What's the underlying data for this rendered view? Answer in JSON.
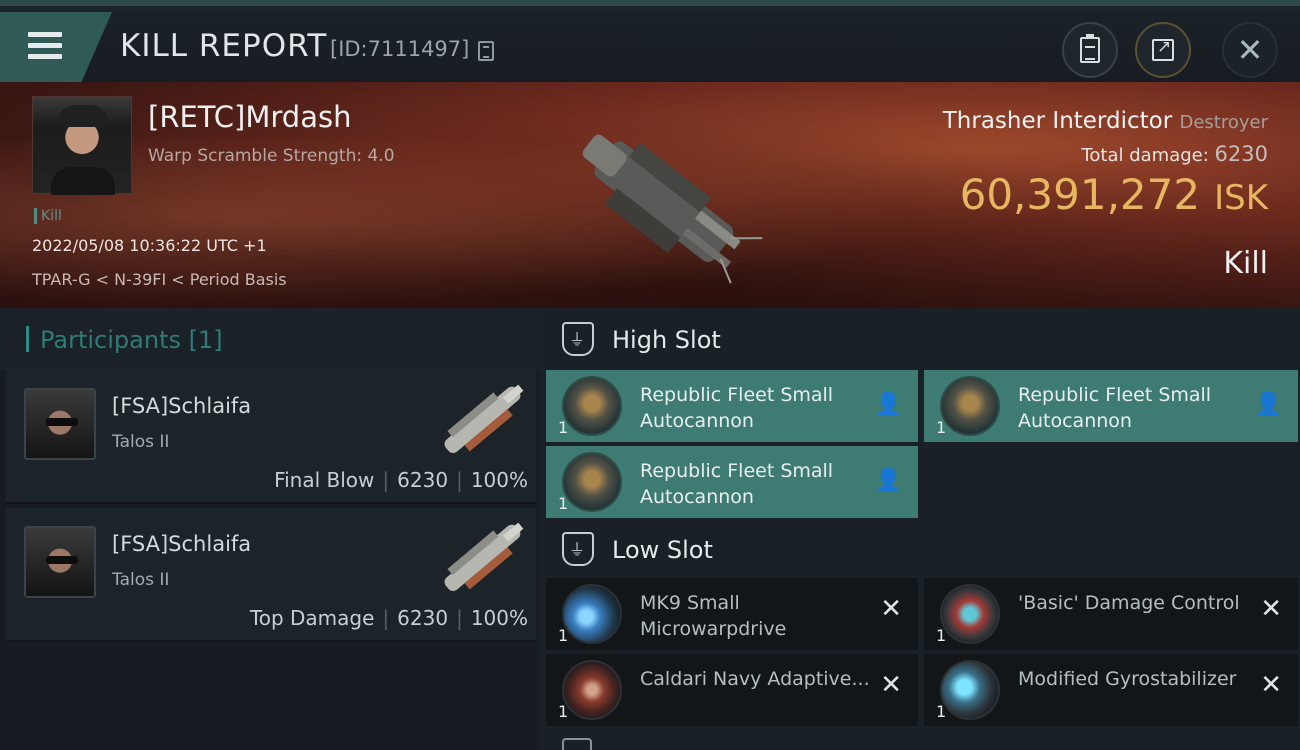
{
  "header": {
    "title": "KILL REPORT",
    "kill_id": "[ID:7111497]"
  },
  "victim": {
    "name": "[RETC]Mrdash",
    "warp_scramble": "Warp Scramble Strength: 4.0",
    "kill_tag": "Kill",
    "datetime": "2022/05/08 10:36:22 UTC +1",
    "location": "TPAR-G < N-39FI < Period Basis",
    "ship_name": "Thrasher Interdictor",
    "ship_class": "Destroyer",
    "total_damage_label": "Total damage:",
    "total_damage": "6230",
    "isk_value": "60,391,272",
    "isk_unit": "ISK",
    "result": "Kill"
  },
  "participants": {
    "header": "Participants [1]",
    "rows": [
      {
        "name": "[FSA]Schlaifa",
        "ship": "Talos II",
        "role": "Final Blow",
        "damage": "6230",
        "percent": "100%"
      },
      {
        "name": "[FSA]Schlaifa",
        "ship": "Talos II",
        "role": "Top Damage",
        "damage": "6230",
        "percent": "100%"
      }
    ]
  },
  "fitting": {
    "high_slot": {
      "title": "High Slot",
      "modules": [
        {
          "qty": "1",
          "name": "Republic Fleet Small Autocannon",
          "status": "online"
        },
        {
          "qty": "1",
          "name": "Republic Fleet Small Autocannon",
          "status": "online"
        },
        {
          "qty": "1",
          "name": "Republic Fleet Small Autocannon",
          "status": "online"
        }
      ]
    },
    "low_slot": {
      "title": "Low Slot",
      "modules": [
        {
          "qty": "1",
          "name": "MK9 Small Microwarpdrive",
          "status": "destroyed"
        },
        {
          "qty": "1",
          "name": "'Basic' Damage Control",
          "status": "destroyed"
        },
        {
          "qty": "1",
          "name": "Caldari Navy Adaptive...",
          "status": "destroyed"
        },
        {
          "qty": "1",
          "name": "Modified Gyrostabilizer",
          "status": "destroyed"
        }
      ]
    }
  },
  "colors": {
    "accent_teal": "#3e7c73",
    "isk_gold": "#e6b660"
  },
  "icons": {
    "menu": "hamburger-icon",
    "copy": "copy-icon",
    "clipboard": "clipboard-icon",
    "share": "share-icon",
    "close": "close-icon",
    "online": "person-icon",
    "destroyed": "x-icon"
  }
}
